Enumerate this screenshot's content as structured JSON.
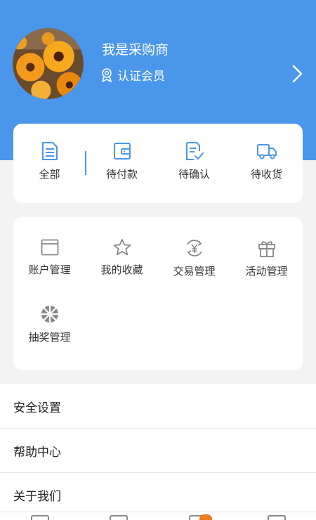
{
  "profile": {
    "username": "我是采购商",
    "member_label": "认证会员"
  },
  "orders": {
    "items": [
      {
        "label": "全部",
        "icon": "document-icon"
      },
      {
        "label": "待付款",
        "icon": "wallet-icon"
      },
      {
        "label": "待确认",
        "icon": "checklist-icon"
      },
      {
        "label": "待收货",
        "icon": "truck-icon"
      }
    ]
  },
  "tools": {
    "items": [
      {
        "label": "账户管理",
        "icon": "account-card-icon"
      },
      {
        "label": "我的收藏",
        "icon": "star-icon"
      },
      {
        "label": "交易管理",
        "icon": "yuan-exchange-icon"
      },
      {
        "label": "活动管理",
        "icon": "gift-icon"
      },
      {
        "label": "抽奖管理",
        "icon": "wheel-icon"
      }
    ]
  },
  "settings": {
    "items": [
      {
        "label": "安全设置"
      },
      {
        "label": "帮助中心"
      },
      {
        "label": "关于我们"
      }
    ]
  },
  "colors": {
    "accent": "#4a96ea",
    "badge": "#f07a1c"
  }
}
